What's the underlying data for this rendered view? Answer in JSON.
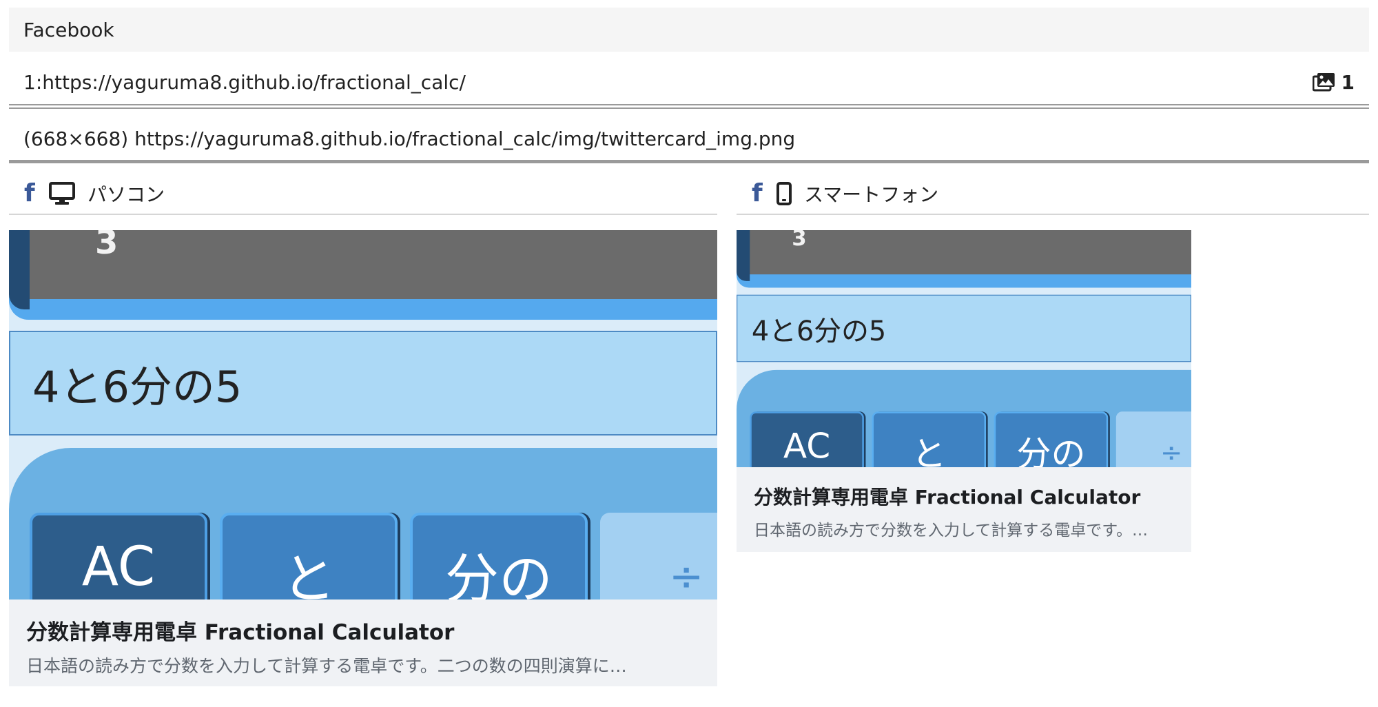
{
  "header": {
    "platform": "Facebook"
  },
  "page": {
    "url_line": "1:https://yaguruma8.github.io/fractional_calc/",
    "image_count": "1",
    "image_line": "(668×668) https://yaguruma8.github.io/fractional_calc/img/twittercard_img.png"
  },
  "sections": {
    "pc": {
      "label": "パソコン",
      "icon": "desktop-icon"
    },
    "sp": {
      "label": "スマートフォン",
      "icon": "smartphone-icon"
    }
  },
  "preview_image": {
    "lcd_digit": "3",
    "readout": "4と6分の5",
    "keys": [
      "AC",
      "と",
      "分の",
      "÷"
    ]
  },
  "card": {
    "title": "分数計算専用電卓 Fractional Calculator",
    "desc_pc": "日本語の読み方で分数を入力して計算する電卓です。二つの数の四則演算に…",
    "desc_sp": "日本語の読み方で分数を入力して計算する電卓です。…"
  },
  "colors": {
    "facebook_blue": "#3b5998",
    "card_bg": "#f0f2f5"
  }
}
